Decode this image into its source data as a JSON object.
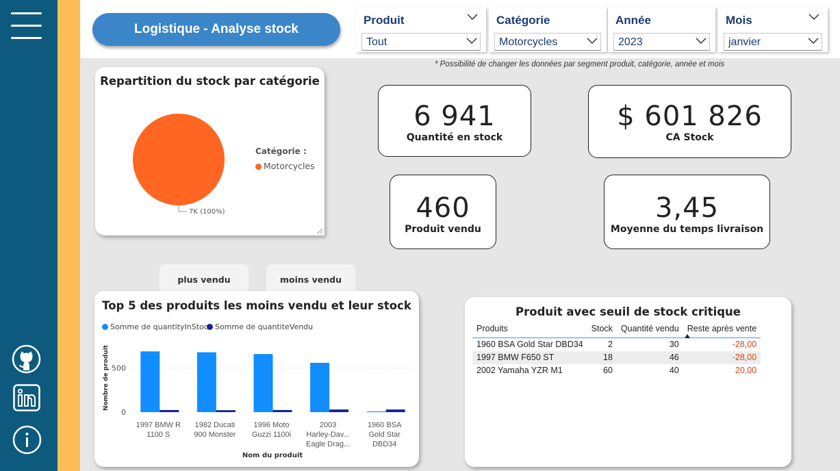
{
  "header": {
    "title": "Logistique - Analyse stock"
  },
  "slicers": [
    {
      "label": "Produit",
      "value": "Tout"
    },
    {
      "label": "Catégorie",
      "value": "Motorcycles"
    },
    {
      "label": "Année",
      "value": "2023"
    },
    {
      "label": "Mois",
      "value": "janvier"
    }
  ],
  "note": "* Possibilité de changer les données par segment produit, catégorie, année et mois",
  "pie": {
    "title": "Repartition du stock par catégorie",
    "legend_title": "Catégorie :",
    "slice_label": "7K (100%)",
    "color": "#ff6622"
  },
  "kpis": {
    "stock_qty": {
      "value": "6 941",
      "label": "Quantité en stock"
    },
    "ca_stock": {
      "value": "$ 601 826",
      "label": "CA Stock"
    },
    "sold": {
      "value": "460",
      "label": "Produit vendu"
    },
    "delivery": {
      "value": "3,45",
      "label": "Moyenne du temps livraison"
    }
  },
  "tabs": {
    "most": "plus vendu",
    "least": "moins vendu"
  },
  "chart_data": [
    {
      "type": "pie",
      "title": "Repartition du stock par catégorie",
      "legend_title": "Catégorie :",
      "categories": [
        "Motorcycles"
      ],
      "values": [
        6941
      ],
      "labels": [
        "7K (100%)"
      ],
      "colors": [
        "#ff6622"
      ]
    },
    {
      "type": "bar",
      "title": "Top 5 des produits les moins vendu et leur stock",
      "xlabel": "Nom du produit",
      "ylabel": "Nombre de produit",
      "ylim": [
        0,
        700
      ],
      "yticks": [
        "0",
        "500"
      ],
      "categories": [
        [
          "1997 BMW R",
          "1100 S"
        ],
        [
          "1982 Ducati",
          "900 Monster"
        ],
        [
          "1996 Moto",
          "Guzzi 1100i"
        ],
        [
          "2003",
          "Harley-Dav...",
          "Eagle Drag..."
        ],
        [
          "1960 BSA",
          "Gold Star",
          "DBD34"
        ]
      ],
      "series": [
        {
          "name": "Somme de quantityInStock",
          "color": "#118dff",
          "values": [
            690,
            680,
            660,
            560,
            8
          ]
        },
        {
          "name": "Somme de quantiteVendu",
          "color": "#12239e",
          "values": [
            24,
            22,
            24,
            30,
            30
          ]
        }
      ]
    }
  ],
  "critical": {
    "title": "Produit avec seuil de stock critique",
    "columns": [
      "Produits",
      "Stock",
      "Quantité vendu",
      "Reste après vente"
    ],
    "rows": [
      [
        "1960 BSA Gold Star DBD34",
        "2",
        "30",
        "-28,00"
      ],
      [
        "1997 BMW F650 ST",
        "18",
        "46",
        "-28,00"
      ],
      [
        "2002 Yamaha YZR M1",
        "60",
        "40",
        "20,00"
      ]
    ],
    "colors": {
      "negative": "#d64513",
      "header_line": "#3a9ad9"
    }
  }
}
